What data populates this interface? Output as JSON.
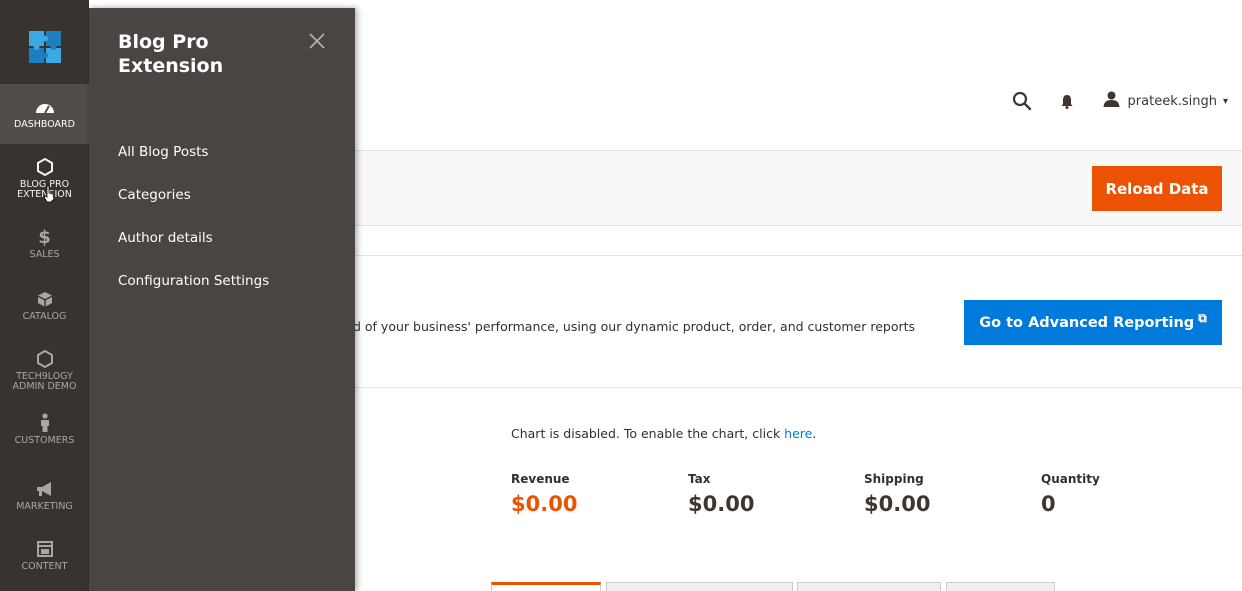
{
  "header": {
    "search_icon": "search-icon",
    "notifications_icon": "bell-icon",
    "user_icon": "user-icon",
    "username": "prateek.singh",
    "user_caret": "▾"
  },
  "action_bar": {
    "reload_label": "Reload Data"
  },
  "advanced_reporting": {
    "description": "d of your business' performance, using our dynamic product, order, and customer reports",
    "button_label": "Go to Advanced Reporting",
    "external_icon": "⧉"
  },
  "dashboard": {
    "chart_disabled_text": "Chart is disabled. To enable the chart, click ",
    "chart_link_text": "here",
    "chart_disabled_suffix": ".",
    "totals": [
      {
        "label": "Revenue",
        "value": "$0.00"
      },
      {
        "label": "Tax",
        "value": "$0.00"
      },
      {
        "label": "Shipping",
        "value": "$0.00"
      },
      {
        "label": "Quantity",
        "value": "0"
      }
    ]
  },
  "nav": {
    "items": [
      {
        "label": "DASHBOARD",
        "icon": "dashboard-icon"
      },
      {
        "label": "BLOG PRO",
        "label2": "EXTENSION",
        "icon": "hexagon-icon"
      },
      {
        "label": "SALES",
        "icon": "dollar-icon"
      },
      {
        "label": "CATALOG",
        "icon": "box-icon"
      },
      {
        "label": "TECH9LOGY",
        "label2": "ADMIN DEMO",
        "icon": "hexagon-icon"
      },
      {
        "label": "CUSTOMERS",
        "icon": "person-icon"
      },
      {
        "label": "MARKETING",
        "icon": "megaphone-icon"
      },
      {
        "label": "CONTENT",
        "icon": "layout-icon"
      }
    ]
  },
  "submenu": {
    "title": "Blog Pro Extension",
    "close_icon": "close-icon",
    "items": [
      {
        "label": "All Blog Posts"
      },
      {
        "label": "Categories"
      },
      {
        "label": "Author details"
      },
      {
        "label": "Configuration Settings"
      }
    ]
  },
  "colors": {
    "accent_orange": "#eb5202",
    "accent_blue": "#007bdb",
    "nav_bg": "#373330",
    "submenu_bg": "#4a4542"
  }
}
